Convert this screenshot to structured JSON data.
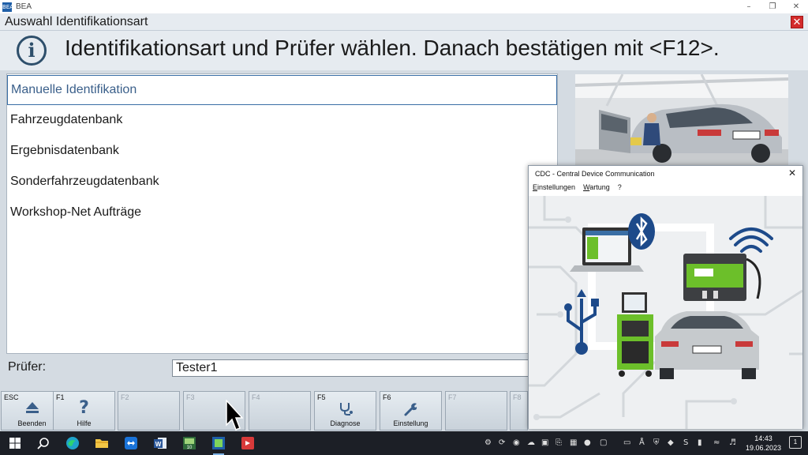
{
  "app": {
    "title": "BEA",
    "icon_text": "BEA"
  },
  "dialog": {
    "title": "Auswahl Identifikationsart",
    "info_text": "Identifikationsart und Prüfer wählen. Danach bestätigen mit <F12>."
  },
  "id_list": [
    "Manuelle Identifikation",
    "Fahrzeugdatenbank",
    "Ergebnisdatenbank",
    "Sonderfahrzeugdatenbank",
    "Workshop-Net Aufträge"
  ],
  "pruefer": {
    "label": "Prüfer:",
    "value": "Tester1"
  },
  "fkeys": [
    {
      "key": "ESC",
      "label": "Beenden",
      "icon": "eject-icon"
    },
    {
      "key": "F1",
      "label": "Hilfe",
      "icon": "help-icon"
    },
    {
      "key": "F2",
      "label": "",
      "icon": ""
    },
    {
      "key": "F3",
      "label": "",
      "icon": ""
    },
    {
      "key": "F4",
      "label": "",
      "icon": ""
    },
    {
      "key": "F5",
      "label": "Diagnose",
      "icon": "stethoscope-icon"
    },
    {
      "key": "F6",
      "label": "Einstellung",
      "icon": "wrench-icon"
    },
    {
      "key": "F7",
      "label": "",
      "icon": ""
    },
    {
      "key": "F8",
      "label": "",
      "icon": ""
    }
  ],
  "cdc": {
    "title": "CDC - Central Device Communication",
    "menu": [
      "Einstellungen",
      "Wartung",
      "?"
    ]
  },
  "taskbar": {
    "time": "14:43",
    "date": "19.06.2023",
    "notification_count": "1"
  },
  "colors": {
    "accent": "#3a6ea5",
    "header_bg": "#e6ebf0",
    "close_red": "#d32b2b",
    "bosch_green": "#6cbf2a"
  }
}
